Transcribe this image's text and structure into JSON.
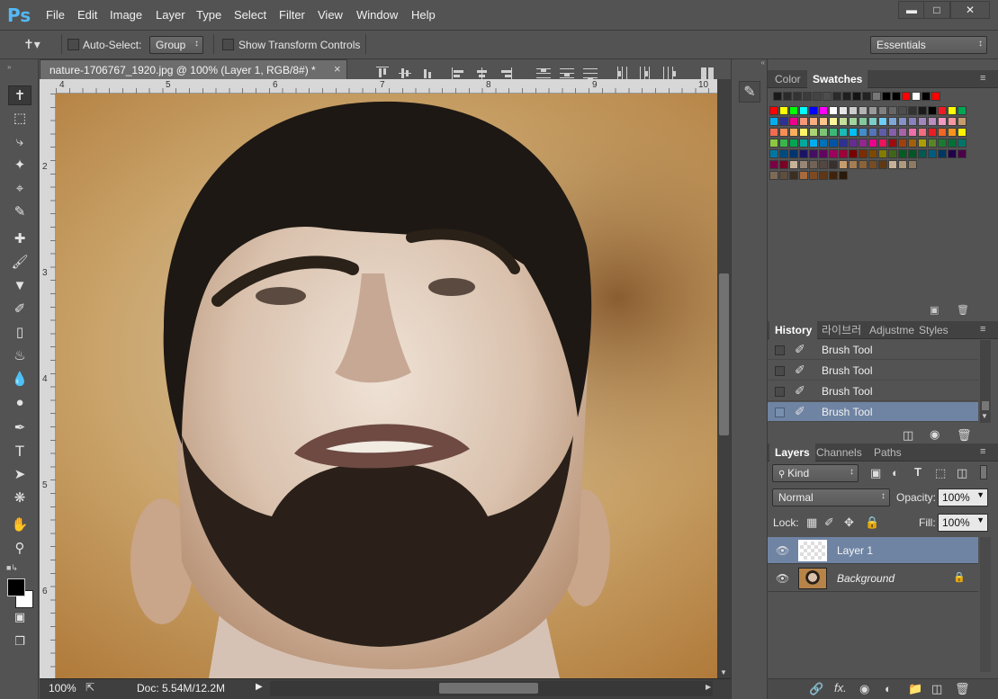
{
  "menubar": {
    "logo": "Ps",
    "items": [
      "File",
      "Edit",
      "Image",
      "Layer",
      "Type",
      "Select",
      "Filter",
      "View",
      "Window",
      "Help"
    ],
    "window_buttons": [
      "▬",
      "□",
      "✕"
    ]
  },
  "options": {
    "auto_select_label": "Auto-Select:",
    "auto_select_value": "Group",
    "show_transform_label": "Show Transform Controls",
    "workspace": "Essentials"
  },
  "document": {
    "tab_title": "nature-1706767_1920.jpg @ 100% (Layer 1, RGB/8#) *",
    "close": "×",
    "ruler_h": [
      "4",
      "5",
      "6",
      "7",
      "8",
      "9",
      "10"
    ],
    "ruler_v": [
      "2",
      "3",
      "4",
      "5",
      "6"
    ]
  },
  "status": {
    "zoom": "100%",
    "doc": "Doc: 5.54M/12.2M"
  },
  "swatches_panel": {
    "tabs": [
      "Color",
      "Swatches"
    ],
    "active": "Swatches",
    "row1": [
      "#1a1a1a",
      "#2a2a2a",
      "#333333",
      "#3c3c3c",
      "#444444",
      "#4d4d4d",
      "#2b2b2b",
      "#1f1f1f",
      "#141414",
      "#222222",
      "#777777",
      "#000000",
      "#000000",
      "#ff0000",
      "#ffffff",
      "#000000",
      "#ff0000"
    ],
    "rows": [
      [
        "#ff0000",
        "#ffff00",
        "#00ff00",
        "#00ffff",
        "#0000ff",
        "#ff00ff",
        "#ffffff",
        "#e6e6e6",
        "#cccccc",
        "#b3b3b3",
        "#999999",
        "#808080",
        "#666666",
        "#4d4d4d",
        "#333333",
        "#1a1a1a",
        "#000000",
        "#ed1c24",
        "#ffff00",
        "#00a651"
      ],
      [
        "#00aeef",
        "#2e3192",
        "#ec008c",
        "#f7977a",
        "#f9ad81",
        "#fdc68a",
        "#fff79a",
        "#c4df9b",
        "#a2d39c",
        "#82ca9d",
        "#7bcdc8",
        "#6ecff6",
        "#7ea7d8",
        "#8493ca",
        "#8882be",
        "#a187be",
        "#bc8dbf",
        "#f49ac2",
        "#f6989d",
        "#c69c6d"
      ],
      [
        "#f26c4f",
        "#f68e55",
        "#fbaf5c",
        "#fff467",
        "#acd372",
        "#7cc576",
        "#3bb878",
        "#1abbb4",
        "#00bff3",
        "#438ccb",
        "#5574b9",
        "#605ca8",
        "#855fa8",
        "#a763a8",
        "#f06ea9",
        "#f26d7d",
        "#ed1c24",
        "#f26522",
        "#f7941d",
        "#fff200"
      ],
      [
        "#8dc63f",
        "#39b54a",
        "#00a651",
        "#00a99d",
        "#00aeef",
        "#0072bc",
        "#0054a6",
        "#2e3192",
        "#662d91",
        "#92278f",
        "#ec008c",
        "#ed145b",
        "#9e0b0f",
        "#a0410d",
        "#a3620a",
        "#aba000",
        "#598527",
        "#1a7b30",
        "#007236",
        "#00746b"
      ],
      [
        "#0076a3",
        "#004b80",
        "#003471",
        "#1b1464",
        "#440e62",
        "#630460",
        "#9e005d",
        "#9e0039",
        "#790000",
        "#7b2e00",
        "#7d4900",
        "#827b00",
        "#406618",
        "#005e20",
        "#005826",
        "#005952",
        "#005b7f",
        "#003663",
        "#21004b",
        "#4b0049"
      ],
      [
        "#7b0046",
        "#7a0026",
        "#c7b299",
        "#998675",
        "#736357",
        "#534741",
        "#37302d",
        "#c69c6d",
        "#a67c52",
        "#8c6239",
        "#754c24",
        "#603913",
        "#c6b198",
        "#b09a7d",
        "#8e7b64"
      ],
      [
        "#7d6a57",
        "#5e4e3c",
        "#3c2f22",
        "#a86a3c",
        "#7f4a22",
        "#5f3616",
        "#3f230d",
        "#2b1909"
      ]
    ]
  },
  "history_panel": {
    "tabs": [
      "History",
      "라이브러",
      "Adjustme",
      "Styles"
    ],
    "active": "History",
    "items": [
      {
        "label": "Brush Tool",
        "selected": false
      },
      {
        "label": "Brush Tool",
        "selected": false
      },
      {
        "label": "Brush Tool",
        "selected": false
      },
      {
        "label": "Brush Tool",
        "selected": true
      }
    ]
  },
  "layers_panel": {
    "tabs": [
      "Layers",
      "Channels",
      "Paths"
    ],
    "active": "Layers",
    "filter": "Kind",
    "blend_mode": "Normal",
    "opacity_label": "Opacity:",
    "opacity": "100%",
    "lock_label": "Lock:",
    "fill_label": "Fill:",
    "fill": "100%",
    "layers": [
      {
        "name": "Layer 1",
        "selected": true,
        "italic": false
      },
      {
        "name": "Background",
        "selected": false,
        "italic": true
      }
    ]
  },
  "colors": {
    "accent": "#53b9f5",
    "selected_row": "#6f84a3",
    "panel": "#535353"
  }
}
